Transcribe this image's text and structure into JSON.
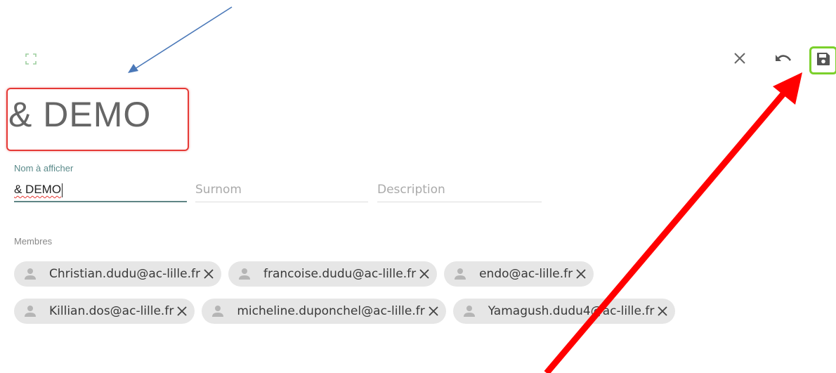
{
  "header": {
    "expand_icon": "expand-icon",
    "close_icon": "close-icon",
    "undo_icon": "undo-icon",
    "save_icon": "save-icon",
    "save_highlight_color": "#7bd02b"
  },
  "title": {
    "text": "& DEMO",
    "highlight_color": "#e53935"
  },
  "form": {
    "display_name_label": "Nom à afficher",
    "display_name_value": "& DEMO",
    "alias_placeholder": "Surnom",
    "description_placeholder": "Description"
  },
  "members": {
    "label": "Membres",
    "items": [
      "Christian.dudu@ac-lille.fr",
      "francoise.dudu@ac-lille.fr",
      "endo@ac-lille.fr",
      "Killian.dos@ac-lille.fr",
      "micheline.duponchel@ac-lille.fr",
      "Yamagush.dudu4@ac-lille.fr"
    ]
  },
  "annotations": {
    "blue_arrow_color": "#4a78b8",
    "red_arrow_color": "#ff0000"
  }
}
